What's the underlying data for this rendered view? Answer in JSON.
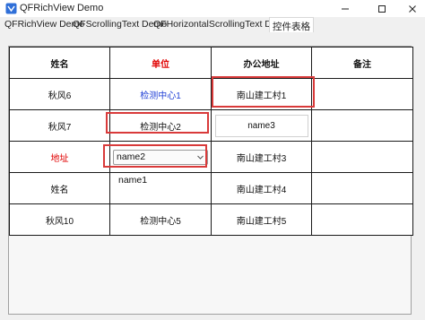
{
  "window": {
    "title": "QFRichView Demo",
    "minimize_icon": "minimize-icon",
    "maximize_icon": "maximize-icon",
    "close_icon": "close-icon"
  },
  "tabs": [
    {
      "label": "QFRichView Demo",
      "active": false
    },
    {
      "label": "QFScrollingText Demo",
      "active": false
    },
    {
      "label": "QFHorizontalScrollingText Demo",
      "active": false
    },
    {
      "label": "控件表格",
      "active": true
    }
  ],
  "table": {
    "headers": [
      {
        "label": "姓名",
        "color": "#111111"
      },
      {
        "label": "单位",
        "color": "#e00000"
      },
      {
        "label": "办公地址",
        "color": "#111111"
      },
      {
        "label": "备注",
        "color": "#111111"
      }
    ],
    "rows": [
      {
        "name": "秋风6",
        "unit": "检测中心1",
        "address": "南山建工村1",
        "note": ""
      },
      {
        "name": "秋风7",
        "unit": "检测中心2",
        "address": "name3",
        "note": ""
      },
      {
        "name": "地址",
        "unit": "name2",
        "address": "南山建工村3",
        "note": ""
      },
      {
        "name": "姓名",
        "unit": "name1",
        "address": "南山建工村4",
        "note": ""
      },
      {
        "name": "秋风10",
        "unit": "检测中心5",
        "address": "南山建工村5",
        "note": ""
      }
    ]
  },
  "colors": {
    "red_text": "#e00000",
    "blue_text": "#1f3fd6",
    "highlight_border": "#d93a3a"
  }
}
